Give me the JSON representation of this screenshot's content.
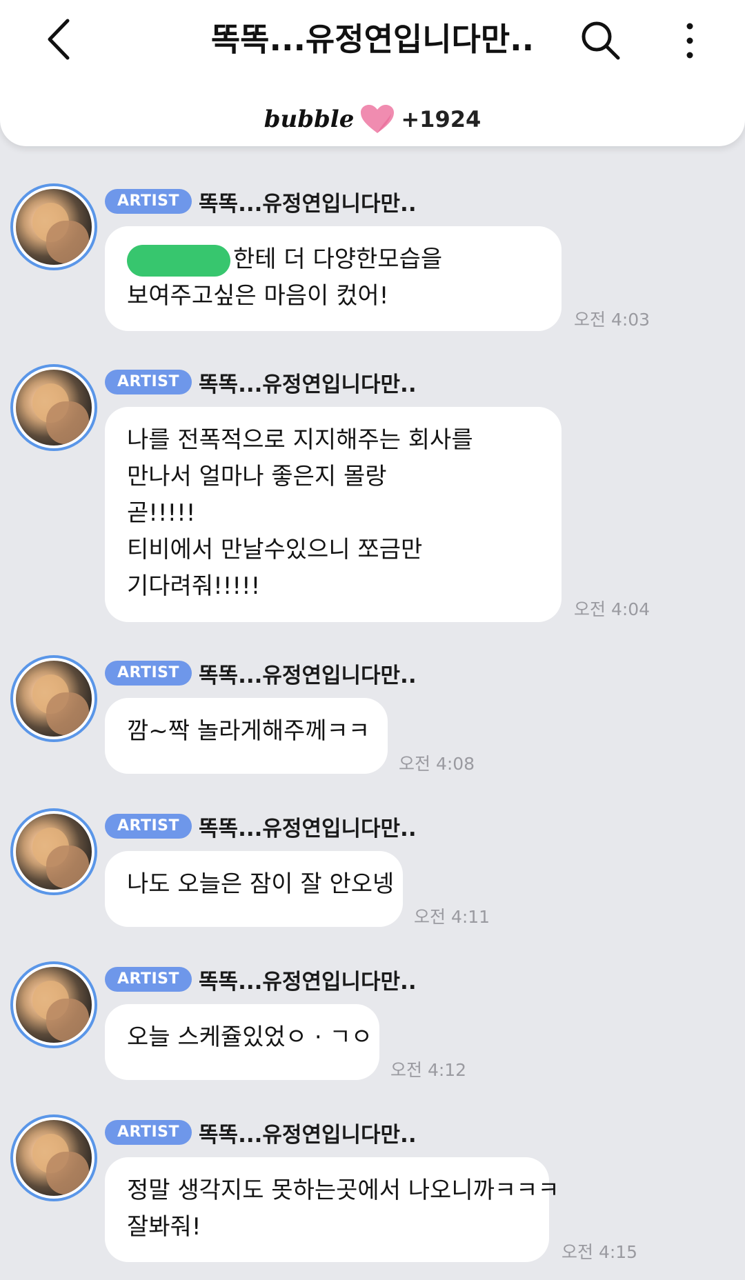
{
  "header": {
    "title": "똑똑...유정연입니다만..",
    "brand": "bubble",
    "heart_count": "+1924",
    "heart_color": "#f08cb0"
  },
  "messages": [
    {
      "badge": "ARTIST",
      "sender": "똑똑...유정연입니다만..",
      "lines": [
        "한테 더 다양한모습을",
        "보여주고싶은 마음이 컸어!"
      ],
      "time": "오전 4:03"
    },
    {
      "badge": "ARTIST",
      "sender": "똑똑...유정연입니다만..",
      "lines": [
        "나를 전폭적으로 지지해주는 회사를",
        "만나서 얼마나 좋은지 몰랑",
        "곧!!!!!",
        "티비에서 만날수있으니 쪼금만",
        "기다려줘!!!!!"
      ],
      "time": "오전 4:04"
    },
    {
      "badge": "ARTIST",
      "sender": "똑똑...유정연입니다만..",
      "lines": [
        "깜~짝 놀라게해주께ㅋㅋ"
      ],
      "time": "오전 4:08"
    },
    {
      "badge": "ARTIST",
      "sender": "똑똑...유정연입니다만..",
      "lines": [
        "나도 오늘은 잠이 잘 안오넹"
      ],
      "time": "오전 4:11"
    },
    {
      "badge": "ARTIST",
      "sender": "똑똑...유정연입니다만..",
      "lines": [
        "오늘 스케쥴있었ㅇ · ㄱㅇ"
      ],
      "time": "오전 4:12"
    },
    {
      "badge": "ARTIST",
      "sender": "똑똑...유정연입니다만..",
      "lines": [
        "정말 생각지도 못하는곳에서 나오니까ㅋㅋㅋ",
        "잘봐줘!"
      ],
      "time": "오전 4:15"
    }
  ],
  "colors": {
    "background": "#e7e8ec",
    "badge": "#6e97ea",
    "avatar_ring": "#5a96e8",
    "censor_mark": "#37c66e"
  },
  "icons": [
    "back-icon",
    "search-icon",
    "more-vertical-icon",
    "heart-icon"
  ]
}
